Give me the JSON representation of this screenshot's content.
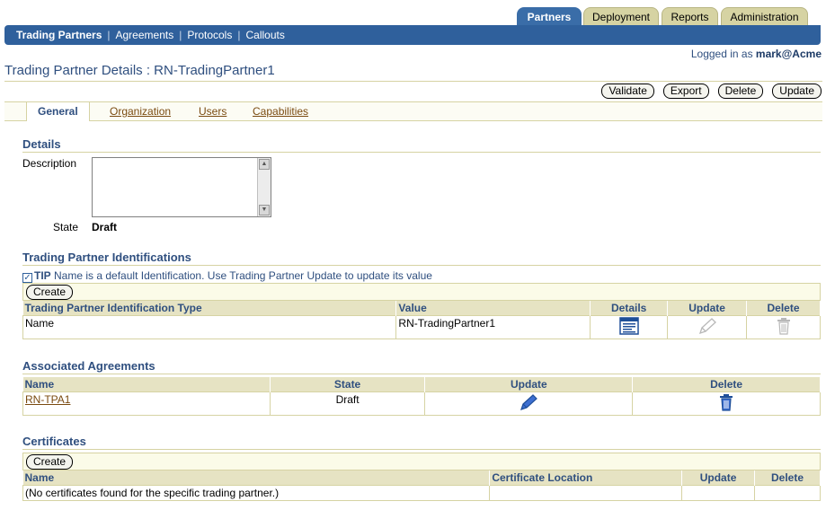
{
  "top_tabs": [
    "Partners",
    "Deployment",
    "Reports",
    "Administration"
  ],
  "nav": {
    "items": [
      "Trading Partners",
      "Agreements",
      "Protocols",
      "Callouts"
    ],
    "separator": "|"
  },
  "logged_in": {
    "prefix": "Logged in as",
    "user": "mark@Acme"
  },
  "page_title": "Trading Partner Details : RN-TradingPartner1",
  "actions": {
    "validate": "Validate",
    "export": "Export",
    "delete": "Delete",
    "update": "Update"
  },
  "sub_tabs": [
    "General",
    "Organization",
    "Users",
    "Capabilities"
  ],
  "details": {
    "header": "Details",
    "description_label": "Description",
    "description_value": "",
    "state_label": "State",
    "state_value": "Draft"
  },
  "identifications": {
    "header": "Trading Partner Identifications",
    "tip_label": "TIP",
    "tip_text": "Name is a default Identification. Use Trading Partner Update to update its value",
    "create_label": "Create",
    "columns": [
      "Trading Partner Identification Type",
      "Value",
      "Details",
      "Update",
      "Delete"
    ],
    "rows": [
      {
        "type": "Name",
        "value": "RN-TradingPartner1"
      }
    ]
  },
  "agreements": {
    "header": "Associated Agreements",
    "columns": [
      "Name",
      "State",
      "Update",
      "Delete"
    ],
    "rows": [
      {
        "name": "RN-TPA1",
        "state": "Draft"
      }
    ]
  },
  "certificates": {
    "header": "Certificates",
    "create_label": "Create",
    "columns": [
      "Name",
      "Certificate Location",
      "Update",
      "Delete"
    ],
    "empty_text": "(No certificates found for the specific trading partner.)"
  },
  "colors": {
    "nav_blue": "#2f609c",
    "header_tan": "#e6e3c3",
    "link_brown": "#7a4a10",
    "title_blue": "#2f4f7f"
  }
}
